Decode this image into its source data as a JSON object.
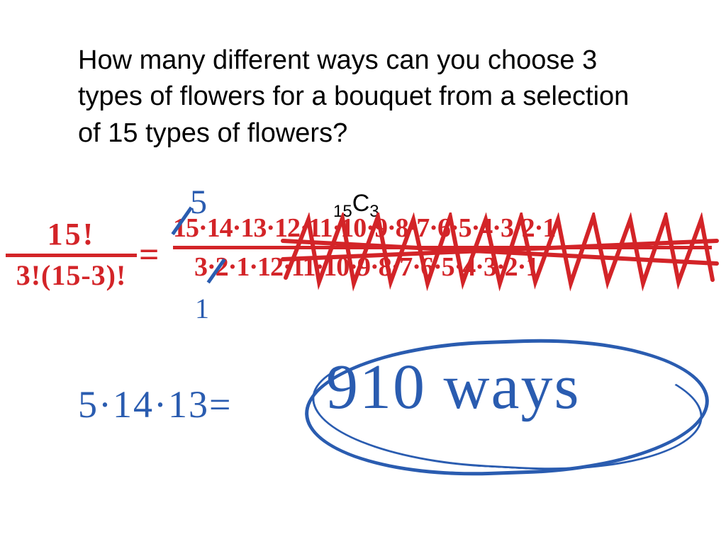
{
  "question": "How many different ways can you choose 3 types of flowers for a bouquet from a selection of 15 types of flowers?",
  "notation": {
    "n": "15",
    "sym": "C",
    "r": "3"
  },
  "formula": {
    "numerator": "15!",
    "denominator": "3!(15-3)!"
  },
  "expansion": {
    "numerator": "15·14·13·12·11·10·9·8·7·6·5·4·3·2·1",
    "denominator": "3·2·1·12·11·10·9·8·7·6·5·4·3·2·1"
  },
  "simplify": {
    "top_note": "5",
    "bottom_note": "1"
  },
  "final": {
    "calc": "5·14·13=",
    "answer": "910 ways"
  },
  "colors": {
    "red": "#d32428",
    "blue": "#2a5cb0"
  }
}
